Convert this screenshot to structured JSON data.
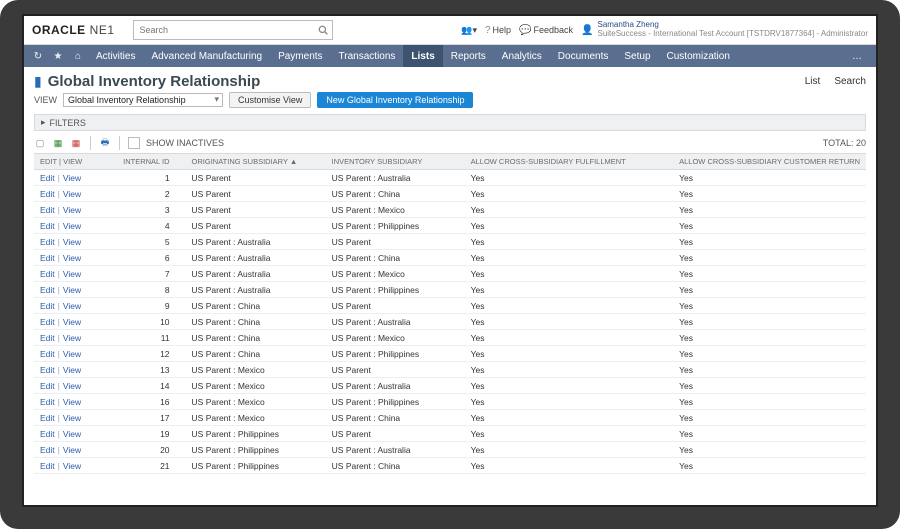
{
  "top": {
    "logo_main": "ORACLE",
    "logo_sub": "NE1",
    "search_placeholder": "Search",
    "help": "Help",
    "feedback": "Feedback",
    "user_name": "Samantha Zheng",
    "user_sub": "SuiteSuccess - International Test Account [TSTDRV1877364] - Administrator"
  },
  "nav": {
    "items": [
      "Activities",
      "Advanced Manufacturing",
      "Payments",
      "Transactions",
      "Lists",
      "Reports",
      "Analytics",
      "Documents",
      "Setup",
      "Customization"
    ],
    "active_index": 4,
    "more": "…"
  },
  "page": {
    "title": "Global Inventory Relationship",
    "right_links": [
      "List",
      "Search"
    ]
  },
  "view": {
    "label": "VIEW",
    "selected": "Global Inventory Relationship",
    "customise": "Customise View",
    "new_btn": "New Global Inventory Relationship"
  },
  "filters_label": "FILTERS",
  "toolbar": {
    "show_inactives": "SHOW INACTIVES",
    "total_label": "TOTAL:",
    "total_value": "20"
  },
  "columns": {
    "edit": "EDIT | VIEW",
    "id": "INTERNAL ID",
    "orig": "ORIGINATING SUBSIDIARY ▲",
    "inv": "INVENTORY SUBSIDIARY",
    "fulfill": "ALLOW CROSS-SUBSIDIARY FULFILLMENT",
    "return": "ALLOW CROSS-SUBSIDIARY CUSTOMER RETURN"
  },
  "edit_label": "Edit",
  "view_label": "View",
  "rows": [
    {
      "id": "1",
      "orig": "US Parent",
      "inv": "US Parent : Australia",
      "fulfill": "Yes",
      "return": "Yes"
    },
    {
      "id": "2",
      "orig": "US Parent",
      "inv": "US Parent : China",
      "fulfill": "Yes",
      "return": "Yes"
    },
    {
      "id": "3",
      "orig": "US Parent",
      "inv": "US Parent : Mexico",
      "fulfill": "Yes",
      "return": "Yes"
    },
    {
      "id": "4",
      "orig": "US Parent",
      "inv": "US Parent : Philippines",
      "fulfill": "Yes",
      "return": "Yes"
    },
    {
      "id": "5",
      "orig": "US Parent : Australia",
      "inv": "US Parent",
      "fulfill": "Yes",
      "return": "Yes"
    },
    {
      "id": "6",
      "orig": "US Parent : Australia",
      "inv": "US Parent : China",
      "fulfill": "Yes",
      "return": "Yes"
    },
    {
      "id": "7",
      "orig": "US Parent : Australia",
      "inv": "US Parent : Mexico",
      "fulfill": "Yes",
      "return": "Yes"
    },
    {
      "id": "8",
      "orig": "US Parent : Australia",
      "inv": "US Parent : Philippines",
      "fulfill": "Yes",
      "return": "Yes"
    },
    {
      "id": "9",
      "orig": "US Parent : China",
      "inv": "US Parent",
      "fulfill": "Yes",
      "return": "Yes"
    },
    {
      "id": "10",
      "orig": "US Parent : China",
      "inv": "US Parent : Australia",
      "fulfill": "Yes",
      "return": "Yes"
    },
    {
      "id": "11",
      "orig": "US Parent : China",
      "inv": "US Parent : Mexico",
      "fulfill": "Yes",
      "return": "Yes"
    },
    {
      "id": "12",
      "orig": "US Parent : China",
      "inv": "US Parent : Philippines",
      "fulfill": "Yes",
      "return": "Yes"
    },
    {
      "id": "13",
      "orig": "US Parent : Mexico",
      "inv": "US Parent",
      "fulfill": "Yes",
      "return": "Yes"
    },
    {
      "id": "14",
      "orig": "US Parent : Mexico",
      "inv": "US Parent : Australia",
      "fulfill": "Yes",
      "return": "Yes"
    },
    {
      "id": "16",
      "orig": "US Parent : Mexico",
      "inv": "US Parent : Philippines",
      "fulfill": "Yes",
      "return": "Yes"
    },
    {
      "id": "17",
      "orig": "US Parent : Mexico",
      "inv": "US Parent : China",
      "fulfill": "Yes",
      "return": "Yes"
    },
    {
      "id": "19",
      "orig": "US Parent : Philippines",
      "inv": "US Parent",
      "fulfill": "Yes",
      "return": "Yes"
    },
    {
      "id": "20",
      "orig": "US Parent : Philippines",
      "inv": "US Parent : Australia",
      "fulfill": "Yes",
      "return": "Yes"
    },
    {
      "id": "21",
      "orig": "US Parent : Philippines",
      "inv": "US Parent : China",
      "fulfill": "Yes",
      "return": "Yes"
    }
  ]
}
